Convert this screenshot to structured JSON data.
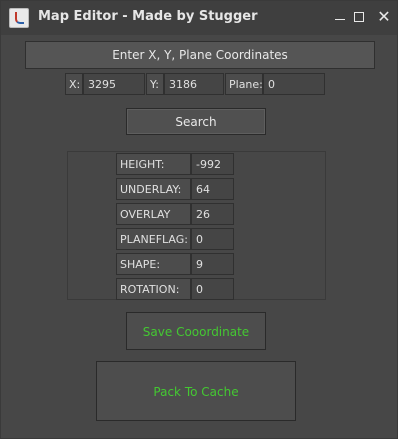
{
  "window": {
    "title": "Map Editor - Made by Stugger",
    "controls": {
      "close": "✕"
    }
  },
  "header": {
    "label": "Enter X, Y, Plane Coordinates"
  },
  "coords": {
    "x_label": "X:",
    "x_value": "3295",
    "y_label": "Y:",
    "y_value": "3186",
    "plane_label": "Plane:",
    "plane_value": "0"
  },
  "search": {
    "label": "Search"
  },
  "properties": [
    {
      "label": "HEIGHT:",
      "value": "-992"
    },
    {
      "label": "UNDERLAY:",
      "value": "64"
    },
    {
      "label": "OVERLAY",
      "value": "26"
    },
    {
      "label": "PLANEFLAG:",
      "value": "0"
    },
    {
      "label": "SHAPE:",
      "value": "9"
    },
    {
      "label": "ROTATION:",
      "value": "0"
    }
  ],
  "actions": {
    "save_label": "Save Cooordinate",
    "pack_label": "Pack To Cache",
    "accent_color": "#44c832"
  }
}
